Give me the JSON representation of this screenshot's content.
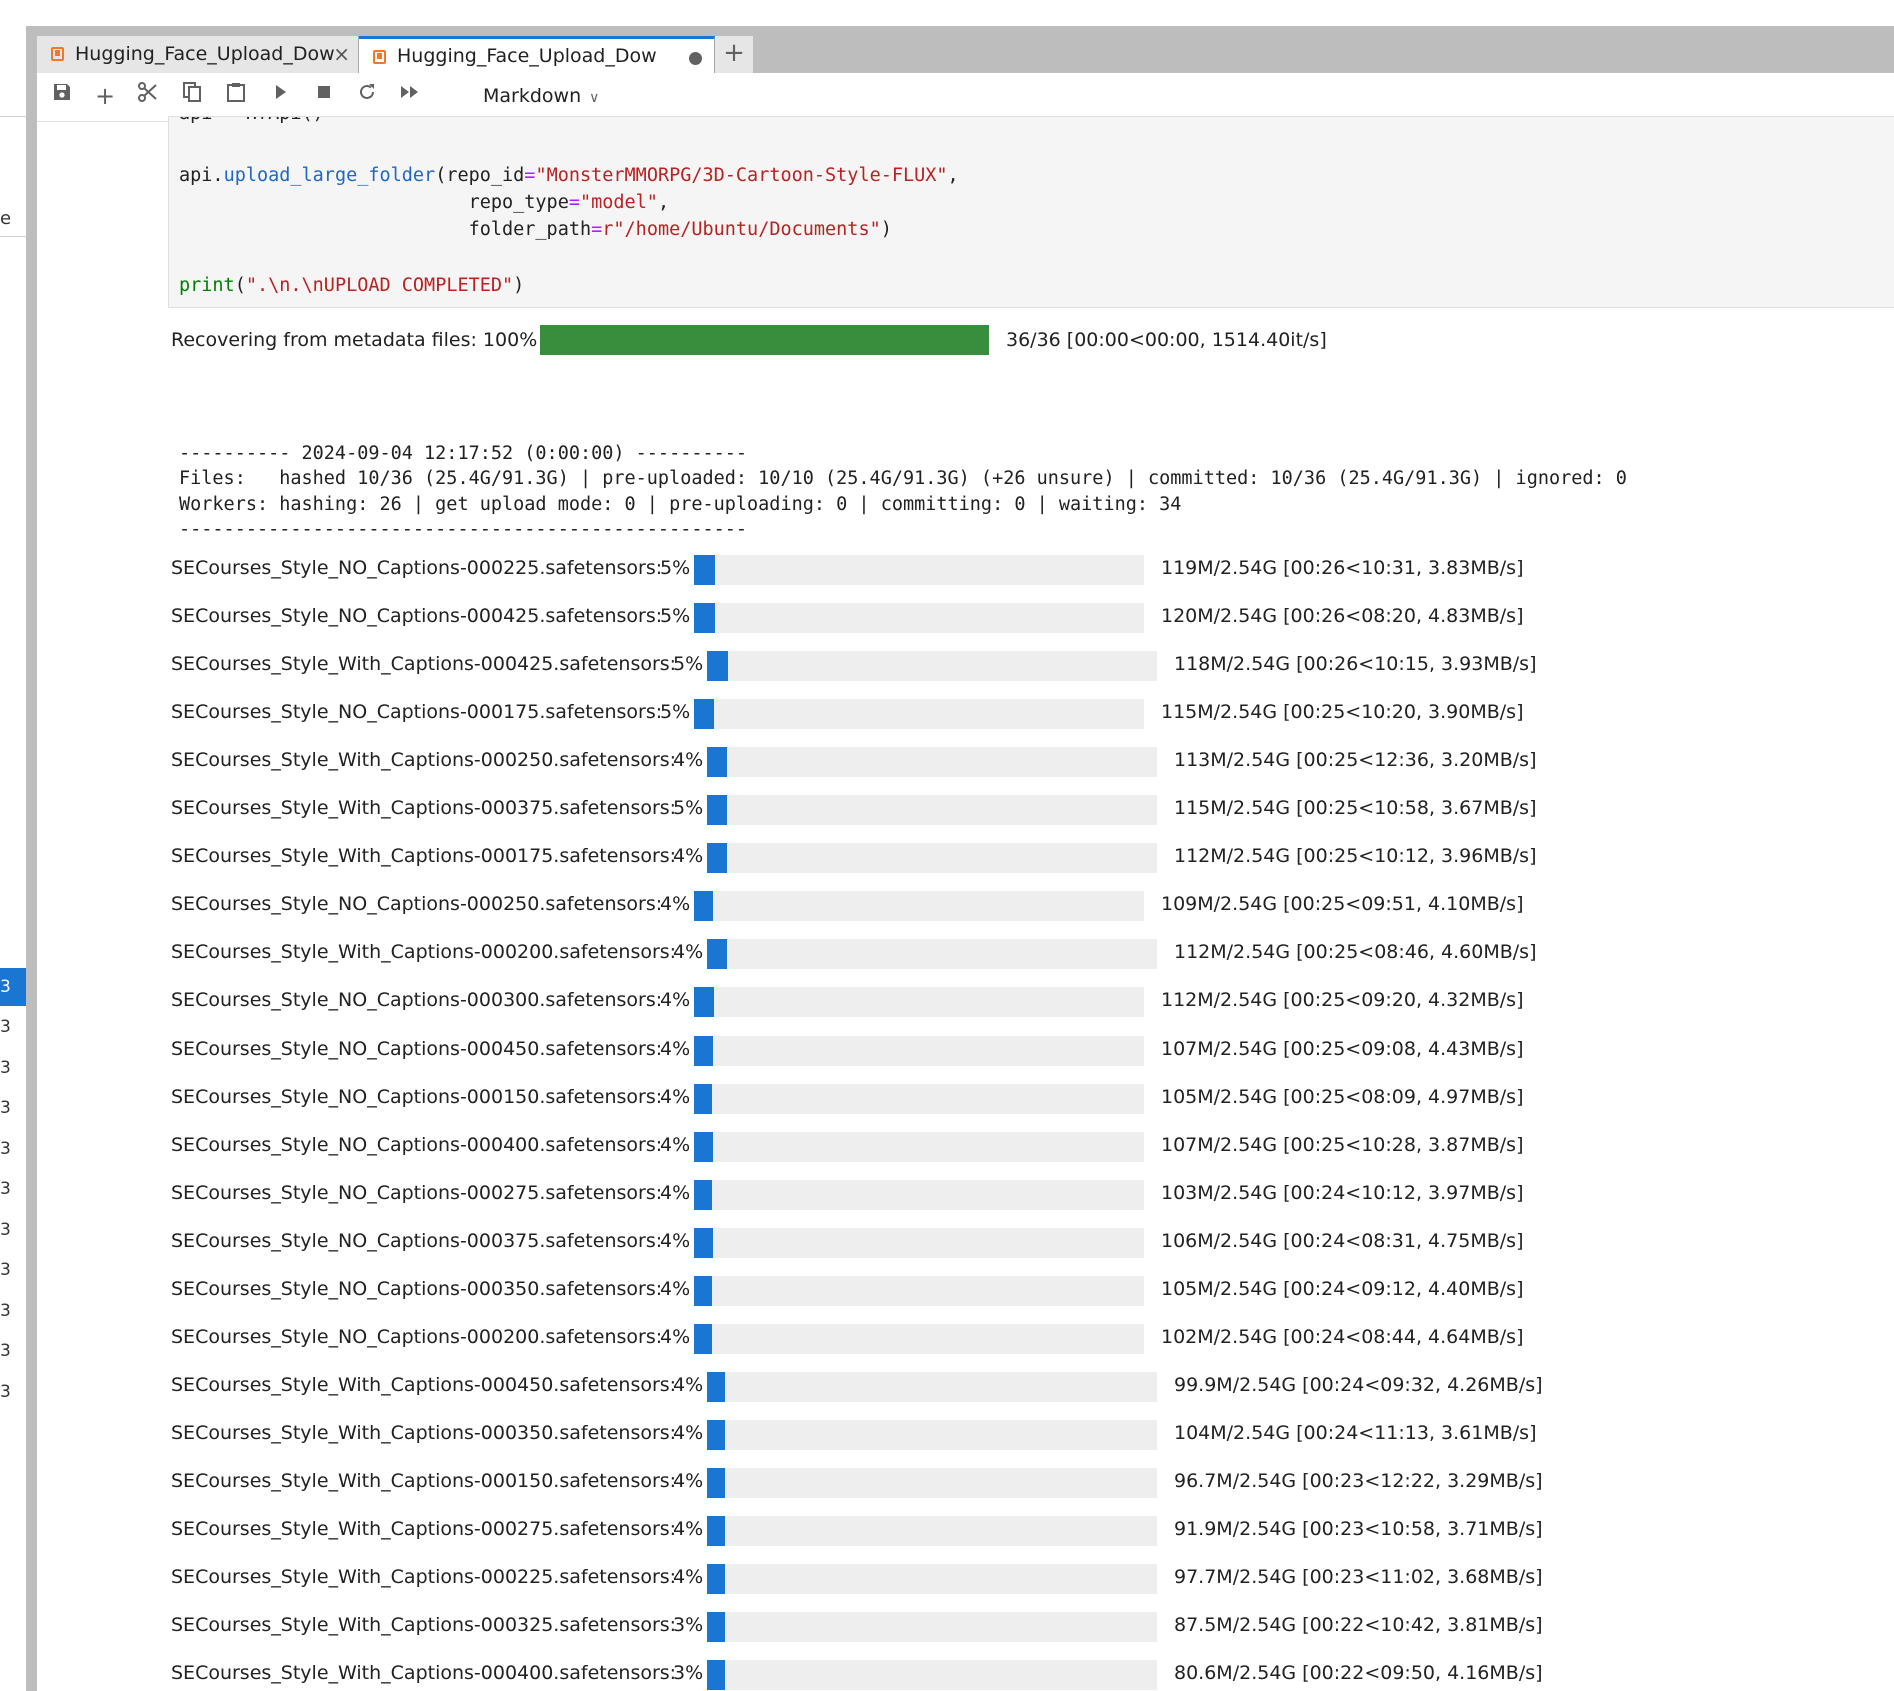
{
  "tabs": [
    {
      "label": "Hugging_Face_Upload_Dow",
      "active": false,
      "close": "×"
    },
    {
      "label": "Hugging_Face_Upload_Dow",
      "active": true,
      "modified": true
    }
  ],
  "new_tab": "+",
  "toolbar": {
    "icons": [
      "save-icon",
      "add-cell-icon",
      "cut-icon",
      "copy-icon",
      "paste-icon",
      "run-icon",
      "stop-icon",
      "restart-icon",
      "fast-forward-icon"
    ],
    "cell_type": "Markdown"
  },
  "left_panel": {
    "mark": "e",
    "selected_number": "3",
    "numbers": [
      "3",
      "3",
      "3",
      "3",
      "3",
      "3",
      "3",
      "3",
      "3",
      "3"
    ]
  },
  "code": {
    "line0": "api = HfApi()",
    "line1_obj": "api",
    "line1_fn": "upload_large_folder",
    "line1_arg": "repo_id",
    "line1_val": "\"MonsterMMORPG/3D-Cartoon-Style-FLUX\"",
    "line2_arg": "repo_type",
    "line2_val": "\"model\"",
    "line3_arg": "folder_path",
    "line3_val": "r\"/home/Ubuntu/Documents\"",
    "line4_fn": "print",
    "line4_val": "\".\\n.\\nUPLOAD COMPLETED\""
  },
  "metadata_progress": {
    "label": "Recovering from metadata files: 100%",
    "percent": 100,
    "stats": "36/36 [00:00<00:00, 1514.40it/s]"
  },
  "status_block": {
    "header": "---------- 2024-09-04 12:17:52 (0:00:00) ----------",
    "files": "Files:   hashed 10/36 (25.4G/91.3G) | pre-uploaded: 10/10 (25.4G/91.3G) (+26 unsure) | committed: 10/36 (25.4G/91.3G) | ignored: 0",
    "workers": "Workers: hashing: 26 | get upload mode: 0 | pre-uploading: 0 | committing: 0 | waiting: 34",
    "footer": "---------------------------------------------------"
  },
  "uploads": [
    {
      "name": "SECourses_Style_NO_Captions-000225.safetensors:",
      "pct": "5%",
      "fraction": 0.047,
      "stats": "119M/2.54G [00:26<10:31, 3.83MB/s]"
    },
    {
      "name": "SECourses_Style_NO_Captions-000425.safetensors:",
      "pct": "5%",
      "fraction": 0.047,
      "stats": "120M/2.54G [00:26<08:20, 4.83MB/s]"
    },
    {
      "name": "SECourses_Style_With_Captions-000425.safetensors:",
      "pct": "5%",
      "fraction": 0.046,
      "stats": "118M/2.54G [00:26<10:15, 3.93MB/s]"
    },
    {
      "name": "SECourses_Style_NO_Captions-000175.safetensors:",
      "pct": "5%",
      "fraction": 0.045,
      "stats": "115M/2.54G [00:25<10:20, 3.90MB/s]"
    },
    {
      "name": "SECourses_Style_With_Captions-000250.safetensors:",
      "pct": "4%",
      "fraction": 0.044,
      "stats": "113M/2.54G [00:25<12:36, 3.20MB/s]"
    },
    {
      "name": "SECourses_Style_With_Captions-000375.safetensors:",
      "pct": "5%",
      "fraction": 0.045,
      "stats": "115M/2.54G [00:25<10:58, 3.67MB/s]"
    },
    {
      "name": "SECourses_Style_With_Captions-000175.safetensors:",
      "pct": "4%",
      "fraction": 0.044,
      "stats": "112M/2.54G [00:25<10:12, 3.96MB/s]"
    },
    {
      "name": "SECourses_Style_NO_Captions-000250.safetensors:",
      "pct": "4%",
      "fraction": 0.043,
      "stats": "109M/2.54G [00:25<09:51, 4.10MB/s]"
    },
    {
      "name": "SECourses_Style_With_Captions-000200.safetensors:",
      "pct": "4%",
      "fraction": 0.044,
      "stats": "112M/2.54G [00:25<08:46, 4.60MB/s]"
    },
    {
      "name": "SECourses_Style_NO_Captions-000300.safetensors:",
      "pct": "4%",
      "fraction": 0.044,
      "stats": "112M/2.54G [00:25<09:20, 4.32MB/s]"
    },
    {
      "name": "SECourses_Style_NO_Captions-000450.safetensors:",
      "pct": "4%",
      "fraction": 0.042,
      "stats": "107M/2.54G [00:25<09:08, 4.43MB/s]"
    },
    {
      "name": "SECourses_Style_NO_Captions-000150.safetensors:",
      "pct": "4%",
      "fraction": 0.041,
      "stats": "105M/2.54G [00:25<08:09, 4.97MB/s]"
    },
    {
      "name": "SECourses_Style_NO_Captions-000400.safetensors:",
      "pct": "4%",
      "fraction": 0.042,
      "stats": "107M/2.54G [00:25<10:28, 3.87MB/s]"
    },
    {
      "name": "SECourses_Style_NO_Captions-000275.safetensors:",
      "pct": "4%",
      "fraction": 0.041,
      "stats": "103M/2.54G [00:24<10:12, 3.97MB/s]"
    },
    {
      "name": "SECourses_Style_NO_Captions-000375.safetensors:",
      "pct": "4%",
      "fraction": 0.042,
      "stats": "106M/2.54G [00:24<08:31, 4.75MB/s]"
    },
    {
      "name": "SECourses_Style_NO_Captions-000350.safetensors:",
      "pct": "4%",
      "fraction": 0.041,
      "stats": "105M/2.54G [00:24<09:12, 4.40MB/s]"
    },
    {
      "name": "SECourses_Style_NO_Captions-000200.safetensors:",
      "pct": "4%",
      "fraction": 0.04,
      "stats": "102M/2.54G [00:24<08:44, 4.64MB/s]"
    },
    {
      "name": "SECourses_Style_With_Captions-000450.safetensors:",
      "pct": "4%",
      "fraction": 0.039,
      "stats": "99.9M/2.54G [00:24<09:32, 4.26MB/s]"
    },
    {
      "name": "SECourses_Style_With_Captions-000350.safetensors:",
      "pct": "4%",
      "fraction": 0.041,
      "stats": "104M/2.54G [00:24<11:13, 3.61MB/s]"
    },
    {
      "name": "SECourses_Style_With_Captions-000150.safetensors:",
      "pct": "4%",
      "fraction": 0.038,
      "stats": "96.7M/2.54G [00:23<12:22, 3.29MB/s]"
    },
    {
      "name": "SECourses_Style_With_Captions-000275.safetensors:",
      "pct": "4%",
      "fraction": 0.036,
      "stats": "91.9M/2.54G [00:23<10:58, 3.71MB/s]"
    },
    {
      "name": "SECourses_Style_With_Captions-000225.safetensors:",
      "pct": "4%",
      "fraction": 0.038,
      "stats": "97.7M/2.54G [00:23<11:02, 3.68MB/s]"
    },
    {
      "name": "SECourses_Style_With_Captions-000325.safetensors:",
      "pct": "3%",
      "fraction": 0.034,
      "stats": "87.5M/2.54G [00:22<10:42, 3.81MB/s]"
    },
    {
      "name": "SECourses_Style_With_Captions-000400.safetensors:",
      "pct": "3%",
      "fraction": 0.032,
      "stats": "80.6M/2.54G [00:22<09:50, 4.16MB/s]"
    }
  ],
  "colors": {
    "accent": "#1976d2",
    "progress_complete": "#388e3c",
    "progress_track": "#eeeeee",
    "code_string": "#ba2121",
    "code_function": "#1e67c4",
    "code_builtin": "#008000",
    "code_operator": "#aa22ff",
    "notebook_icon": "#f37726"
  }
}
